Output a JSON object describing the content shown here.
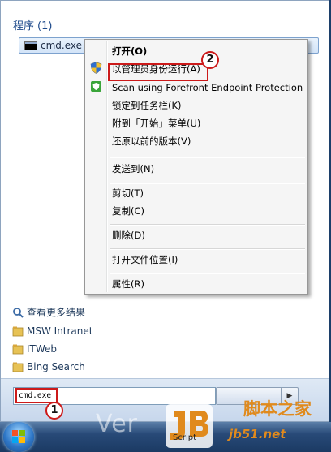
{
  "results": {
    "section_title": "程序",
    "count": "(1)",
    "item": "cmd.exe"
  },
  "context_menu": {
    "items": [
      "打开(O)",
      "以管理员身份运行(A)",
      "Scan using Forefront Endpoint Protection",
      "锁定到任务栏(K)",
      "附到「开始」菜单(U)",
      "还原以前的版本(V)",
      "发送到(N)",
      "剪切(T)",
      "复制(C)",
      "删除(D)",
      "打开文件位置(I)",
      "属性(R)"
    ]
  },
  "links": {
    "see_more": "查看更多结果",
    "items": [
      "MSW Intranet",
      "ITWeb",
      "Bing Search"
    ]
  },
  "search": {
    "value": "cmd.exe"
  },
  "annotations": {
    "step1": "1",
    "step2": "2"
  },
  "watermarks": {
    "vert": "Ver",
    "logo": "Script",
    "site_cn": "脚本之家",
    "site_url": "jb51.net"
  },
  "colors": {
    "highlight": "#cc1a1a",
    "shield_blue": "#2f6fd0",
    "shield_yellow": "#f2c230",
    "forefront_green": "#3aa53a"
  }
}
